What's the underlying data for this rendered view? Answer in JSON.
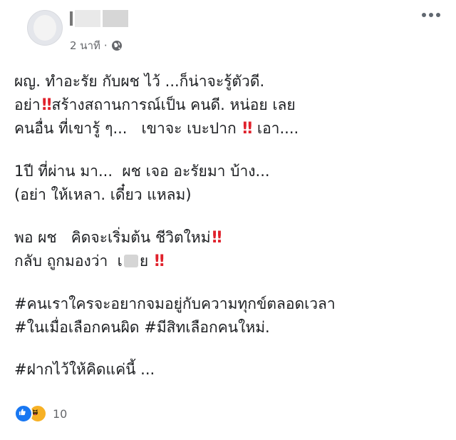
{
  "post": {
    "time": "2 นาที",
    "separator": "·",
    "privacy_icon": "globe-icon",
    "more_icon": "more-options-icon",
    "lines": [
      {
        "text": "ผญ. ทำอะรัย กับผช ไว้ ...ก็น่าจะรู้ตัวดี."
      },
      {
        "pre": "อย่า",
        "post": "สร้างสถานการณ์เป็น คนดี. หน่อย เลย"
      },
      {
        "pre": "คนอื่น ที่เขารู้ ๆ...   เขาจะ เบะปาก",
        "post": "เอา...."
      },
      {
        "text": "1ปี ที่ผ่าน มา...  ผช เจอ อะรัยมา บ้าง..."
      },
      {
        "text": "(อย่า ให้เหลา. เดี๋ยว แหลม)"
      },
      {
        "text": "พอ ผช   คิดจะเริ่มต้น ชีวิตใหม่"
      },
      {
        "pre": "กลับ ถูกมองว่า  เ",
        "post": "ย"
      },
      {
        "text": "#คนเราใครจะอยากจมอยู่กับความทุกข์ตลอดเวลา"
      },
      {
        "text": "#ในเมื่อเลือกคนผิด #มีสิทเลือกคนใหม่."
      },
      {
        "text": "#ฝากไว้ให้คิดแค่นี้ ..."
      }
    ],
    "emphasis_glyph": "‼",
    "emphasis_color": "#e0212b"
  },
  "reactions": {
    "icons": [
      "like-icon",
      "haha-icon"
    ],
    "count": "10",
    "like_color": "#1877f2",
    "haha_color": "#f7b125"
  }
}
